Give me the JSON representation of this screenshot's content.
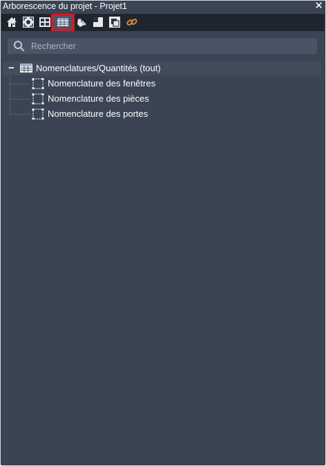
{
  "window": {
    "title": "Arborescence du projet - Projet1",
    "close_glyph": "✕"
  },
  "toolbar": {
    "buttons": [
      {
        "icon": "home-icon"
      },
      {
        "icon": "focus-frame-icon"
      },
      {
        "icon": "layout-grid-icon"
      },
      {
        "icon": "schedule-table-icon",
        "active": true
      },
      {
        "icon": "eraser-icon"
      },
      {
        "icon": "sheet-corner-icon"
      },
      {
        "icon": "group-icon"
      },
      {
        "icon": "link-icon"
      }
    ],
    "highlight_color": "#e8111c"
  },
  "search": {
    "placeholder": "Rechercher",
    "value": ""
  },
  "tree": {
    "root": {
      "toggle": "−",
      "label": "Nomenclatures/Quantités (tout)",
      "icon": "table-icon"
    },
    "children": [
      {
        "label": "Nomenclature des fenêtres",
        "icon": "schedule-item-icon"
      },
      {
        "label": "Nomenclature des pièces",
        "icon": "schedule-item-icon"
      },
      {
        "label": "Nomenclature des portes",
        "icon": "schedule-item-icon"
      }
    ]
  },
  "colors": {
    "panel": "#3b4453",
    "toolbar": "#1f252e",
    "search": "#4a5466",
    "root_row": "#434c5b"
  }
}
